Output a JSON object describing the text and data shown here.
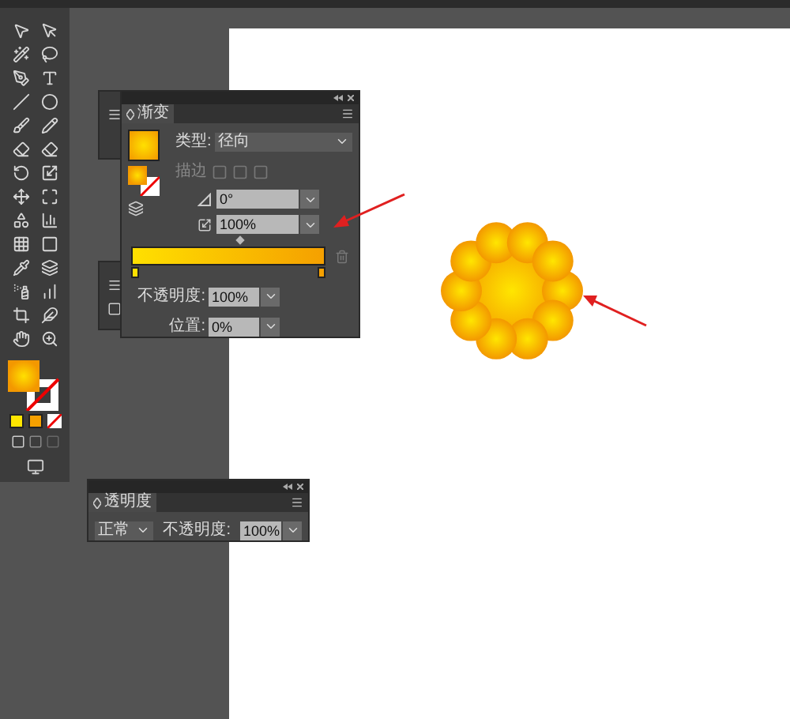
{
  "gradient_panel": {
    "title": "渐变",
    "type_label": "类型:",
    "type_value": "径向",
    "stroke_label": "描边",
    "angle_value": "0°",
    "aspect_value": "100%",
    "opacity_label": "不透明度:",
    "opacity_value": "100%",
    "location_label": "位置:",
    "location_value": "0%"
  },
  "transparency_panel": {
    "title": "透明度",
    "blend_mode": "正常",
    "opacity_label": "不透明度:",
    "opacity_value": "100%"
  }
}
